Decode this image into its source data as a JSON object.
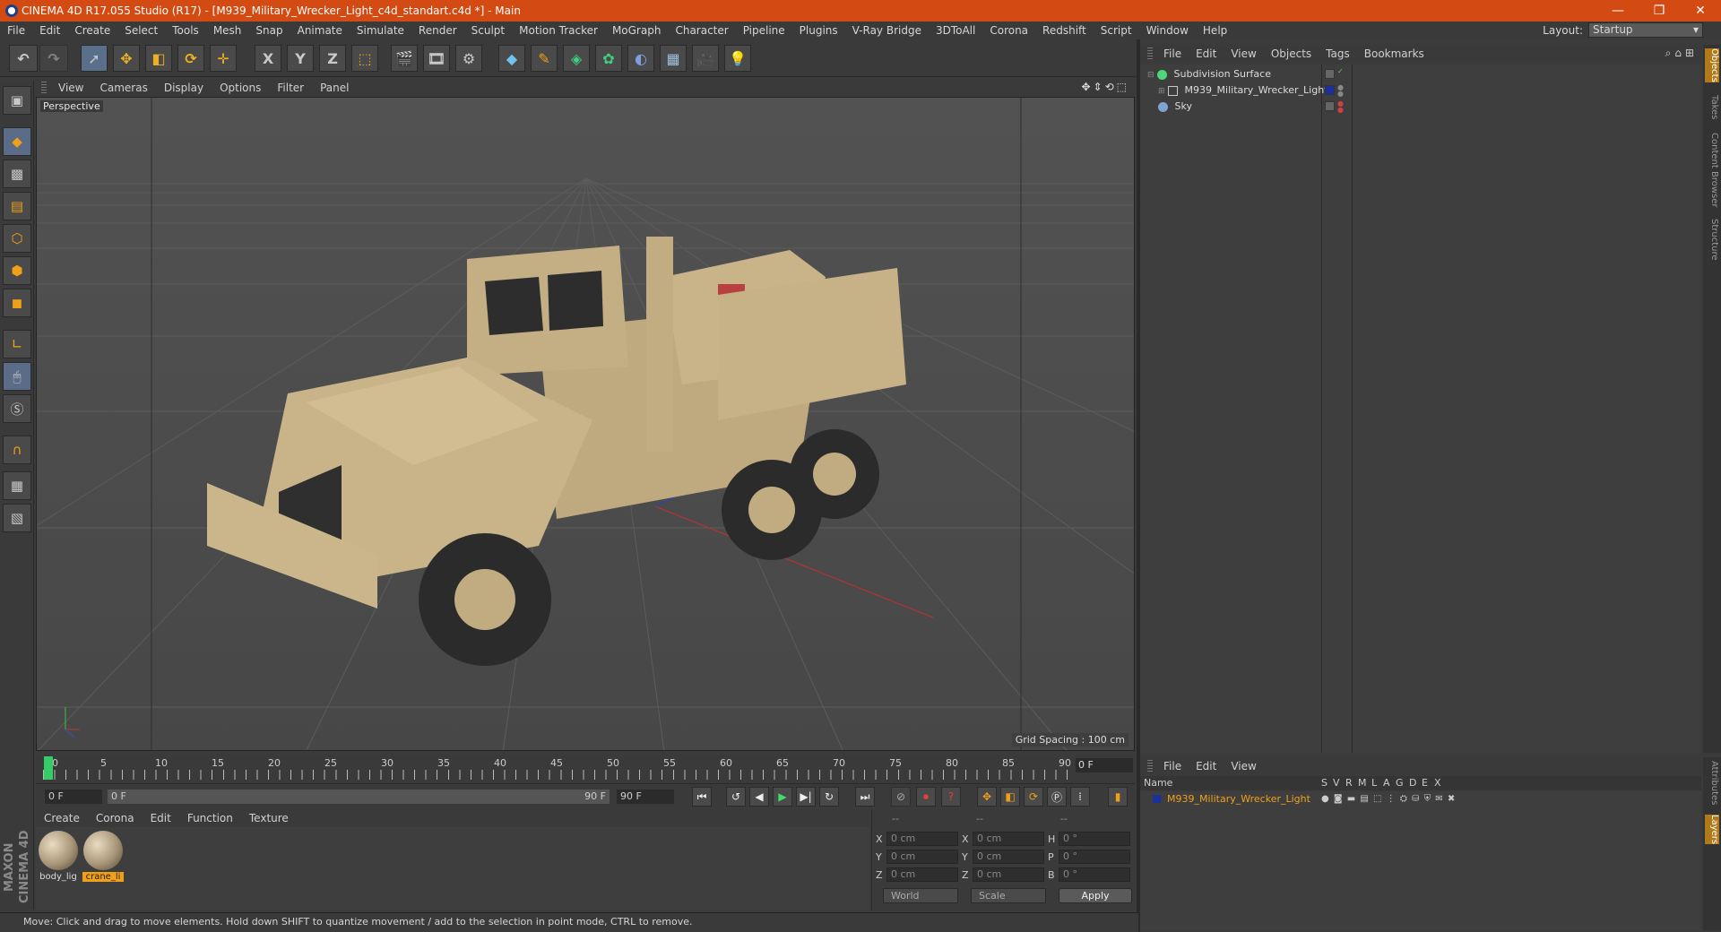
{
  "window": {
    "title": "CINEMA 4D R17.055 Studio (R17) - [M939_Military_Wrecker_Light_c4d_standart.c4d *] - Main",
    "minimize": "—",
    "restore": "❐",
    "close": "✕"
  },
  "menubar": [
    "File",
    "Edit",
    "Create",
    "Select",
    "Tools",
    "Mesh",
    "Snap",
    "Animate",
    "Simulate",
    "Render",
    "Sculpt",
    "Motion Tracker",
    "MoGraph",
    "Character",
    "Pipeline",
    "Plugins",
    "V-Ray Bridge",
    "3DToAll",
    "Corona",
    "Redshift",
    "Script",
    "Window",
    "Help"
  ],
  "layout": {
    "label": "Layout:",
    "value": "Startup"
  },
  "toolbar": {
    "axis_x": "X",
    "axis_y": "Y",
    "axis_z": "Z"
  },
  "viewport": {
    "menu": [
      "View",
      "Cameras",
      "Display",
      "Options",
      "Filter",
      "Panel"
    ],
    "title": "Perspective",
    "grid_spacing": "Grid Spacing : 100 cm",
    "nav_icons": "✥⇕⟲⬚"
  },
  "timeline": {
    "ticks": [
      "0",
      "5",
      "10",
      "15",
      "20",
      "25",
      "30",
      "35",
      "40",
      "45",
      "50",
      "55",
      "60",
      "65",
      "70",
      "75",
      "80",
      "85",
      "90"
    ],
    "end_field": "0 F"
  },
  "transport": {
    "start_field": "0 F",
    "range_start": "0 F",
    "range_end": "90 F",
    "end_field": "90 F"
  },
  "material_panel": {
    "menu": [
      "Create",
      "Corona",
      "Edit",
      "Function",
      "Texture"
    ],
    "materials": [
      {
        "name": "body_lig"
      },
      {
        "name": "crane_li"
      }
    ]
  },
  "coordinates": {
    "headers": [
      "--",
      "--",
      "--"
    ],
    "rows": [
      {
        "a1": "X",
        "v1": "0 cm",
        "a2": "X",
        "v2": "0 cm",
        "a3": "H",
        "v3": "0 °"
      },
      {
        "a1": "Y",
        "v1": "0 cm",
        "a2": "Y",
        "v2": "0 cm",
        "a3": "P",
        "v3": "0 °"
      },
      {
        "a1": "Z",
        "v1": "0 cm",
        "a2": "Z",
        "v2": "0 cm",
        "a3": "B",
        "v3": "0 °"
      }
    ],
    "world_label": "World",
    "scale_label": "Scale",
    "apply_label": "Apply"
  },
  "status": "Move: Click and drag to move elements. Hold down SHIFT to quantize movement / add to the selection in point mode, CTRL to remove.",
  "maxon": "MAXON CINEMA 4D",
  "object_manager": {
    "menu": [
      "File",
      "Edit",
      "View",
      "Objects",
      "Tags",
      "Bookmarks"
    ],
    "header_icons": "⌕⌂⊞",
    "objects": [
      {
        "name": "Subdivision Surface",
        "color": "#4fd67a"
      },
      {
        "name": "M939_Military_Wrecker_Light",
        "color": "#c8c8c8"
      },
      {
        "name": "Sky",
        "color": "#7fa3d4"
      }
    ]
  },
  "right_tabs": [
    "Objects",
    "Takes",
    "Content Browser",
    "Structure"
  ],
  "right_tabs_bottom": [
    "Attributes",
    "Layers"
  ],
  "layer_manager": {
    "menu": [
      "File",
      "Edit",
      "View"
    ],
    "columns": [
      "Name",
      "S",
      "V",
      "R",
      "M",
      "L",
      "A",
      "G",
      "D",
      "E",
      "X"
    ],
    "layer_name": "M939_Military_Wrecker_Light",
    "layer_icons": "● ◙ ▬ ▤ ⬚ ⋮ ⛭ ⛁ ⛨ ✉ ✖"
  },
  "colors": {
    "titlebar": "#d34b12",
    "accent_selection": "#f0a018",
    "truck": "#c9b48a",
    "grid": "#5c5c5c"
  }
}
